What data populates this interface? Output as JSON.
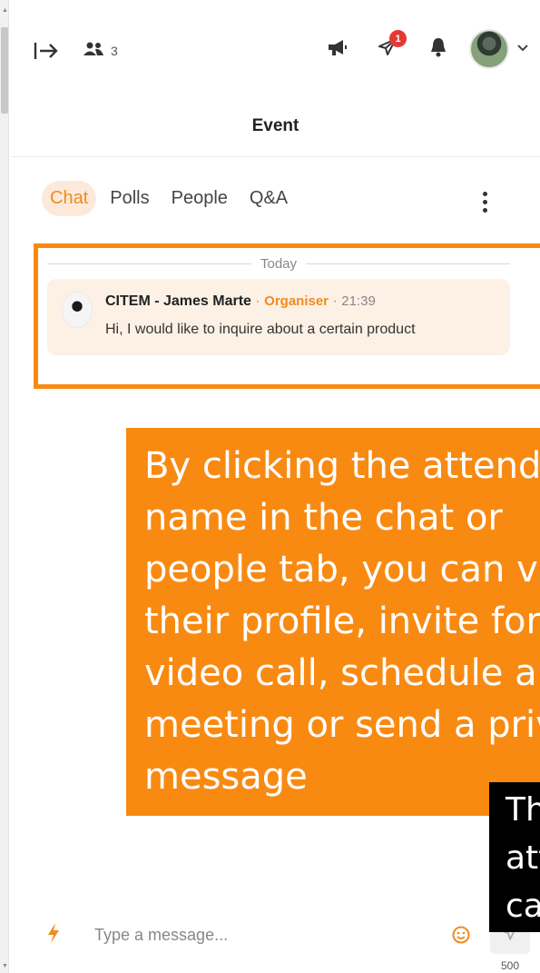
{
  "window": {
    "title": "Event"
  },
  "header": {
    "attendee_count": "3",
    "notification_badge": "1"
  },
  "tabs": [
    {
      "label": "Chat",
      "active": true
    },
    {
      "label": "Polls",
      "active": false
    },
    {
      "label": "People",
      "active": false
    },
    {
      "label": "Q&A",
      "active": false
    }
  ],
  "chat": {
    "day_separator": "Today",
    "messages": [
      {
        "sender": "CITEM - James Marte",
        "separator": " · ",
        "role": "Organiser",
        "time": "21:39",
        "text": "Hi, I would like to inquire about a certain product"
      }
    ]
  },
  "annotations": {
    "orange_callout": "By clicking the attendee's name in the chat or people tab, you can view their profile, invite for a video call, schedule a meeting or send a private message",
    "black_callout": "The attendee can accept and reply"
  },
  "composer": {
    "placeholder": "Type a message...",
    "char_limit": "500"
  },
  "colors": {
    "accent": "#f18a1f",
    "callout": "#f88a12",
    "badge": "#e53935",
    "message_bg": "#fdf1e6"
  },
  "icons": [
    "collapse-panel-icon",
    "people-icon",
    "megaphone-icon",
    "send-plane-icon",
    "bell-icon",
    "chevron-down-icon",
    "more-vertical-icon",
    "bolt-icon",
    "emoji-icon",
    "send-icon"
  ]
}
